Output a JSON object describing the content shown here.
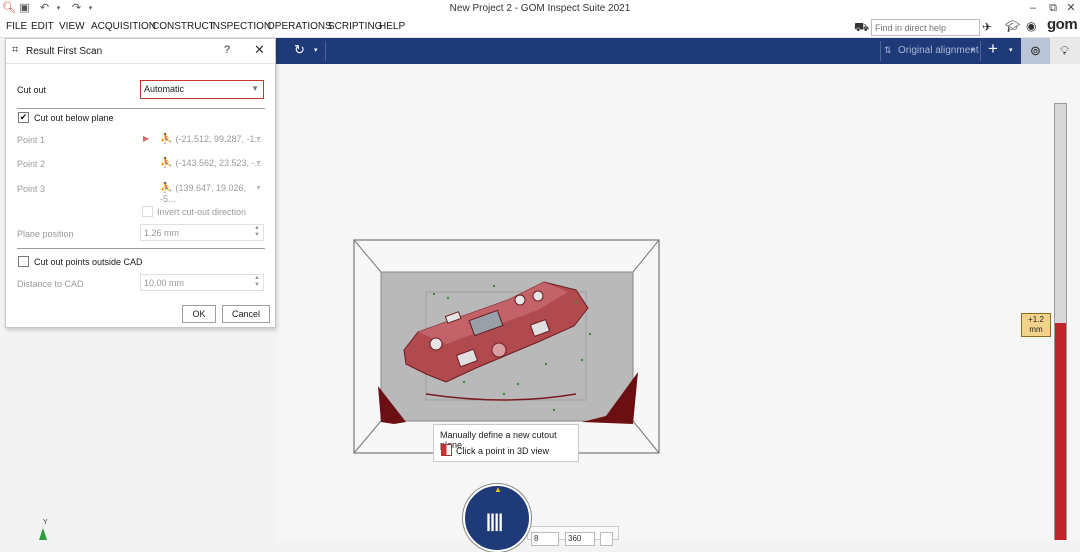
{
  "window": {
    "title": "New Project 2 - GOM Inspect Suite 2021",
    "minimize": "–",
    "restore": "⧉",
    "close": "✕"
  },
  "menu": [
    "FILE",
    "EDIT",
    "VIEW",
    "ACQUISITION",
    "CONSTRUCT",
    "INSPECTION",
    "OPERATIONS",
    "SCRIPTING",
    "HELP"
  ],
  "help_search": {
    "placeholder": "Find in direct help"
  },
  "logo": "gom",
  "toolbar": {
    "alignment_label": "Original alignment"
  },
  "dialog": {
    "title": "Result First Scan",
    "help": "?",
    "close": "✕",
    "cut_out_label": "Cut out",
    "cut_out_value": "Automatic",
    "cut_below_plane_label": "Cut out below plane",
    "cut_below_plane_checked": true,
    "points": [
      {
        "label": "Point 1",
        "value": "(-21.512, 99.287, -1..."
      },
      {
        "label": "Point 2",
        "value": "(-143.562, 23.523, -..."
      },
      {
        "label": "Point 3",
        "value": "(139.647, 19.026, -5..."
      }
    ],
    "invert_label": "Invert cut-out direction",
    "plane_position_label": "Plane position",
    "plane_position_value": "1.26 mm",
    "cut_outside_cad_label": "Cut out points outside CAD",
    "cut_outside_cad_checked": false,
    "distance_label": "Distance to CAD",
    "distance_value": "10.00 mm",
    "ok": "OK",
    "cancel": "Cancel"
  },
  "tooltip": {
    "line1": "Manually define a new cutout plane.",
    "line2": "Click a point in 3D view"
  },
  "slider": {
    "tag": "+1.2\nmm",
    "tag_value": "+1.2",
    "tag_unit": "mm"
  },
  "bottom": {
    "field1": "8",
    "field2": "360",
    "axis_label": "Y"
  },
  "colors": {
    "toolbar_blue": "#1e3a78",
    "scan_red": "#b04a4f",
    "slider_red": "#c0232a",
    "tag_yellow": "#f3d38a"
  }
}
